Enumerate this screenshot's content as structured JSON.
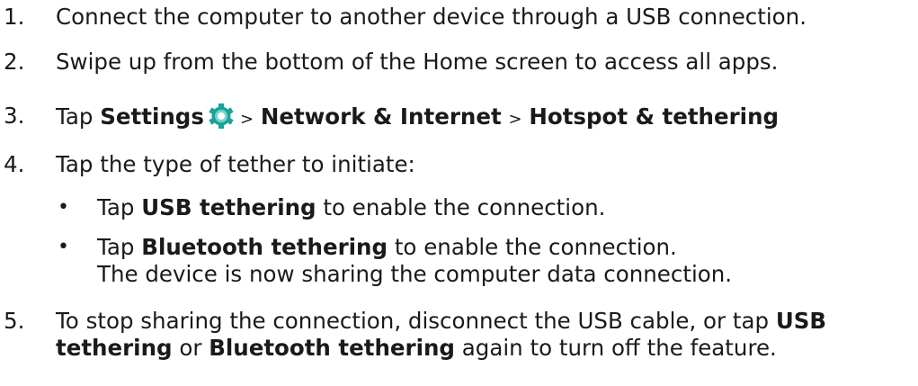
{
  "steps": [
    {
      "number": "1.",
      "text": "Connect the computer to another device through a USB connection."
    },
    {
      "number": "2.",
      "text": "Swipe up from the bottom of the Home screen to access all apps."
    },
    {
      "number": "3.",
      "tap": "Tap",
      "settings": "Settings",
      "sep1": ">",
      "network": "Network & Internet",
      "sep2": ">",
      "hotspot": "Hotspot & tethering"
    },
    {
      "number": "4.",
      "text": "Tap the type of tether to initiate:",
      "bullets": [
        {
          "dot": "•",
          "tap": "Tap",
          "bold": "USB tethering",
          "rest": "to enable the connection."
        },
        {
          "dot": "•",
          "tap": "Tap",
          "bold": "Bluetooth tethering",
          "rest": "to enable the connection.",
          "note": "The device is now sharing the computer data connection."
        }
      ]
    },
    {
      "number": "5.",
      "line1_text": "To stop sharing the connection, disconnect the USB cable, or tap",
      "line1_bold": "USB",
      "line2_bold_a": "tethering",
      "line2_or": "or",
      "line2_bold_b": "Bluetooth tethering",
      "line2_rest": "again to turn off the feature."
    }
  ],
  "icons": {
    "settings_icon": "gear-icon",
    "settings_icon_color": "#1aa39a",
    "settings_icon_inner": "#78d6c9"
  }
}
